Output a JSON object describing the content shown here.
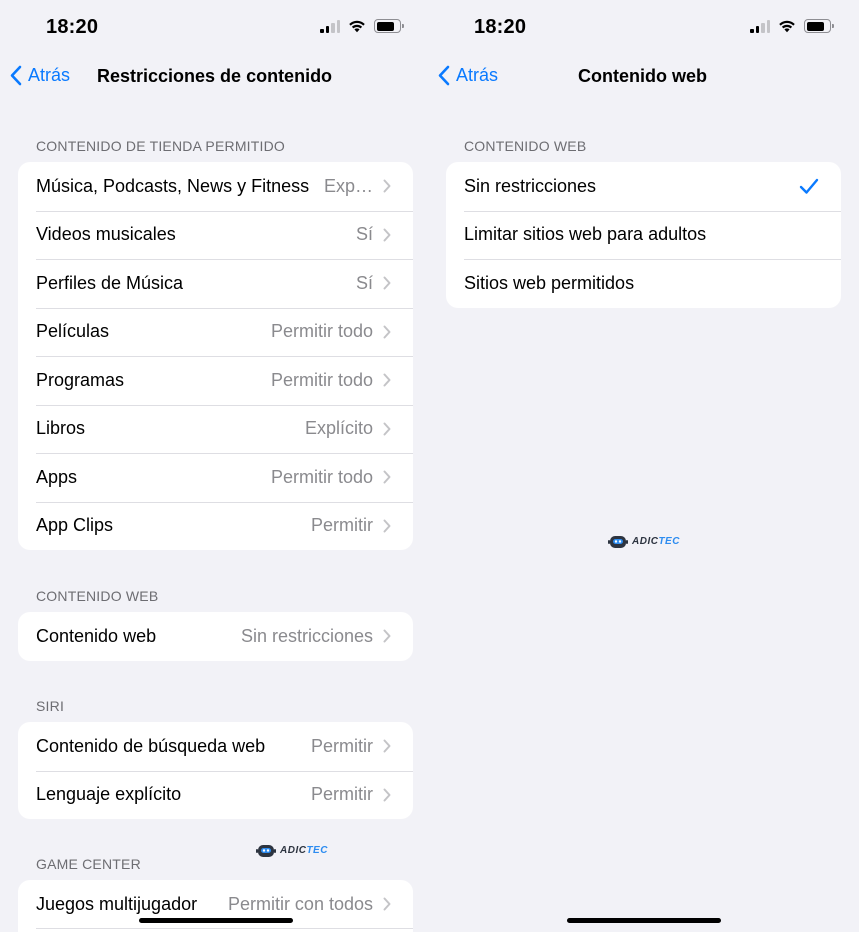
{
  "colors": {
    "accent": "#0a7aff",
    "background": "#f2f2f7",
    "secondary_text": "#8a8a8e"
  },
  "left": {
    "time": "18:20",
    "back_label": "Atrás",
    "title": "Restricciones de contenido",
    "sections": [
      {
        "header": "CONTENIDO DE TIENDA PERMITIDO",
        "rows": [
          {
            "label": "Música, Podcasts, News y Fitness",
            "value": "Exp…"
          },
          {
            "label": "Videos musicales",
            "value": "Sí"
          },
          {
            "label": "Perfiles de Música",
            "value": "Sí"
          },
          {
            "label": "Películas",
            "value": "Permitir todo"
          },
          {
            "label": "Programas",
            "value": "Permitir todo"
          },
          {
            "label": "Libros",
            "value": "Explícito"
          },
          {
            "label": "Apps",
            "value": "Permitir todo"
          },
          {
            "label": "App Clips",
            "value": "Permitir"
          }
        ]
      },
      {
        "header": "CONTENIDO WEB",
        "rows": [
          {
            "label": "Contenido web",
            "value": "Sin restricciones"
          }
        ]
      },
      {
        "header": "SIRI",
        "rows": [
          {
            "label": "Contenido de búsqueda web",
            "value": "Permitir"
          },
          {
            "label": "Lenguaje explícito",
            "value": "Permitir"
          }
        ]
      },
      {
        "header": "GAME CENTER",
        "rows": [
          {
            "label": "Juegos multijugador",
            "value": "Permitir con todos"
          }
        ]
      }
    ]
  },
  "right": {
    "time": "18:20",
    "back_label": "Atrás",
    "title": "Contenido web",
    "section_header": "CONTENIDO WEB",
    "options": [
      {
        "label": "Sin restricciones",
        "selected": true
      },
      {
        "label": "Limitar sitios web para adultos",
        "selected": false
      },
      {
        "label": "Sitios web permitidos",
        "selected": false
      }
    ]
  },
  "watermark": {
    "part1": "ADIC",
    "part2": "TEC"
  }
}
